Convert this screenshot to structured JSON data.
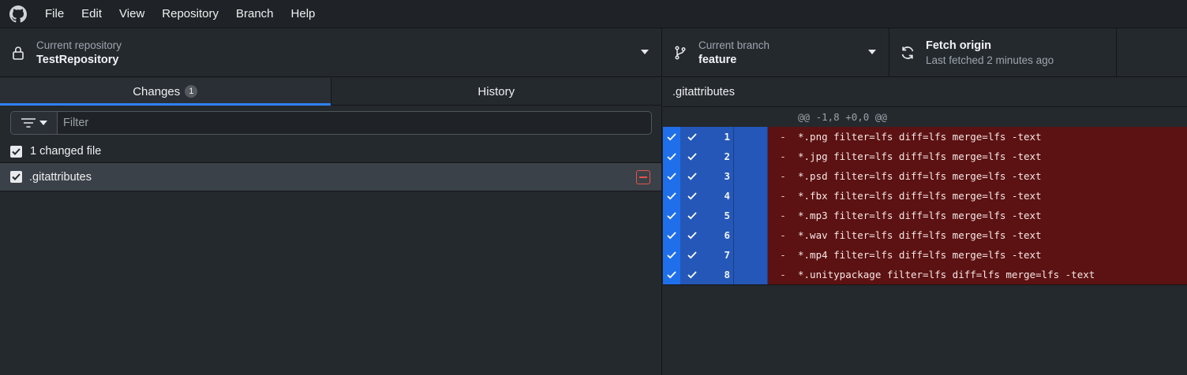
{
  "menu": [
    "File",
    "Edit",
    "View",
    "Repository",
    "Branch",
    "Help"
  ],
  "toolbar": {
    "repo_caption": "Current repository",
    "repo_name": "TestRepository",
    "branch_caption": "Current branch",
    "branch_name": "feature",
    "fetch_title": "Fetch origin",
    "fetch_sub": "Last fetched 2 minutes ago"
  },
  "tabs": {
    "changes_label": "Changes",
    "changes_count": "1",
    "history_label": "History"
  },
  "filter": {
    "placeholder": "Filter"
  },
  "changes": {
    "summary": "1 changed file",
    "files": [
      {
        "name": ".gitattributes",
        "status": "deleted"
      }
    ]
  },
  "diff": {
    "file": ".gitattributes",
    "hunk": "@@ -1,8 +0,0 @@",
    "lines": [
      {
        "num": "1",
        "marker": "-",
        "text": "*.png filter=lfs diff=lfs merge=lfs -text"
      },
      {
        "num": "2",
        "marker": "-",
        "text": "*.jpg filter=lfs diff=lfs merge=lfs -text"
      },
      {
        "num": "3",
        "marker": "-",
        "text": "*.psd filter=lfs diff=lfs merge=lfs -text"
      },
      {
        "num": "4",
        "marker": "-",
        "text": "*.fbx filter=lfs diff=lfs merge=lfs -text"
      },
      {
        "num": "5",
        "marker": "-",
        "text": "*.mp3 filter=lfs diff=lfs merge=lfs -text"
      },
      {
        "num": "6",
        "marker": "-",
        "text": "*.wav filter=lfs diff=lfs merge=lfs -text"
      },
      {
        "num": "7",
        "marker": "-",
        "text": "*.mp4 filter=lfs diff=lfs merge=lfs -text"
      },
      {
        "num": "8",
        "marker": "-",
        "text": "*.unitypackage filter=lfs diff=lfs merge=lfs -text"
      }
    ]
  },
  "colors": {
    "accent": "#2f81f7",
    "deleted_bg": "#5c1212",
    "gutter_selected": "#2457b8",
    "deleted_icon": "#e5534b"
  },
  "icons": {
    "app": "github-icon",
    "repo": "lock-icon",
    "branch": "git-branch-icon",
    "fetch": "sync-icon",
    "filter": "filter-icon",
    "file_status": "file-removed-icon"
  }
}
